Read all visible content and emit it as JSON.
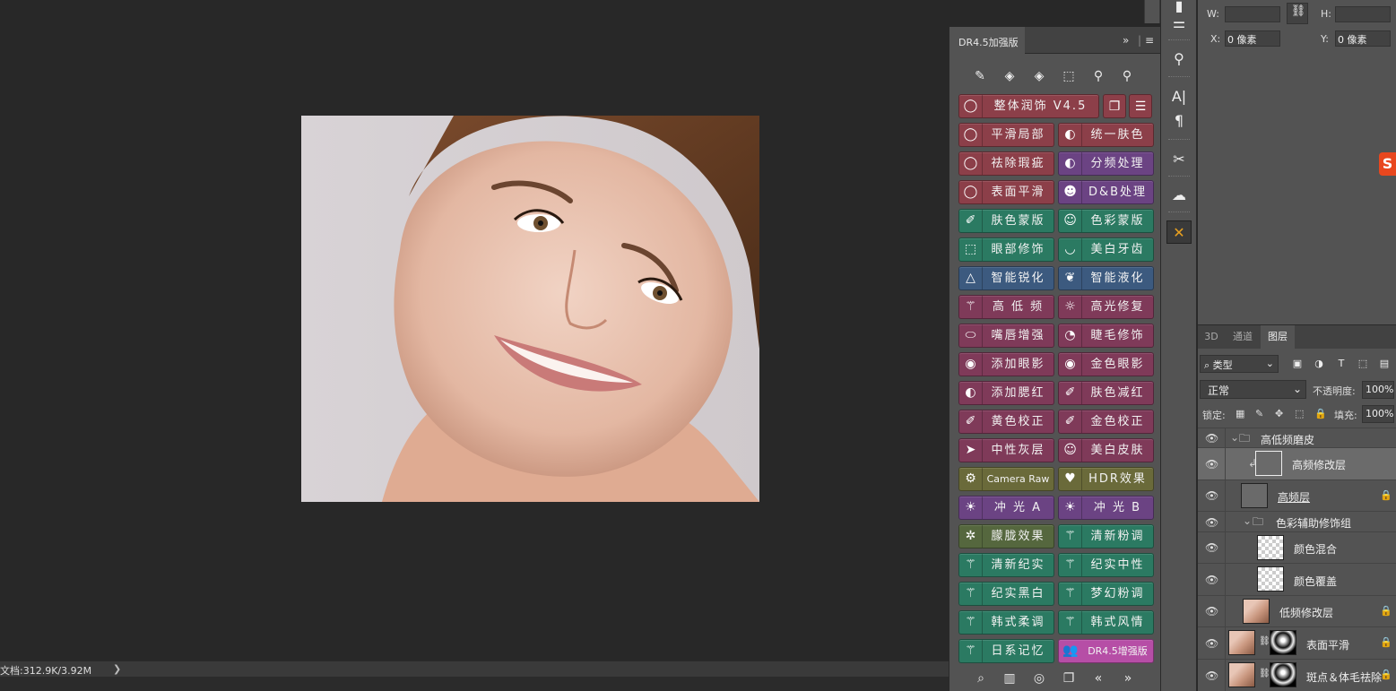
{
  "status": {
    "doc_info": "文档:312.9K/3.92M",
    "arrow": "❯"
  },
  "dr_panel": {
    "tab_title": "DR4.5加强版",
    "expand": "»",
    "menu": "≡",
    "toolbar_icons": [
      "brush-icon",
      "bandage-icon",
      "bandage-icon",
      "selection-icon",
      "stamp-icon",
      "stamp-icon"
    ],
    "buttons": {
      "main": "整体润饰  V4.5",
      "b1": "平滑局部",
      "b2": "统一肤色",
      "b3": "祛除瑕疵",
      "b4": "分频处理",
      "b5": "表面平滑",
      "b6": "D&B处理",
      "b7": "肤色蒙版",
      "b8": "色彩蒙版",
      "b9": "眼部修饰",
      "b10": "美白牙齿",
      "b11": "智能锐化",
      "b12": "智能液化",
      "b13": "高 低 频",
      "b14": "高光修复",
      "b15": "嘴唇增强",
      "b16": "睫毛修饰",
      "b17": "添加眼影",
      "b18": "金色眼影",
      "b19": "添加腮红",
      "b20": "肤色减红",
      "b21": "黄色校正",
      "b22": "金色校正",
      "b23": "中性灰层",
      "b24": "美白皮肤",
      "b25": "Camera Raw",
      "b26": "HDR效果",
      "b27": "冲 光 A",
      "b28": "冲 光 B",
      "b29": "朦胧效果",
      "b30": "清新粉调",
      "b31": "清新纪实",
      "b32": "纪实中性",
      "b33": "纪实黑白",
      "b34": "梦幻粉调",
      "b35": "韩式柔调",
      "b36": "韩式风情",
      "b37": "日系记忆",
      "b38": "DR4.5增强版"
    }
  },
  "toolcol": {
    "char_label": "A|",
    "para_label": "¶"
  },
  "properties": {
    "w_label": "W:",
    "h_label": "H:",
    "x_label": "X:",
    "x_value": "0 像素",
    "y_label": "Y:",
    "y_value": "0 像素"
  },
  "sogou_label": "S",
  "layers_panel": {
    "tabs": [
      "3D",
      "通道",
      "图层"
    ],
    "filter": "⌕ 类型",
    "blend_mode": "正常",
    "opacity_label": "不透明度:",
    "opacity_value": "100%",
    "lock_label": "锁定:",
    "fill_label": "填充:",
    "fill_value": "100%",
    "layers": [
      {
        "name": "高低频磨皮"
      },
      {
        "name": "高频修改层"
      },
      {
        "name": "高频层"
      },
      {
        "name": "色彩辅助修饰组"
      },
      {
        "name": "颜色混合"
      },
      {
        "name": "颜色覆盖"
      },
      {
        "name": "低频修改层"
      },
      {
        "name": "表面平滑"
      },
      {
        "name": "斑点＆体毛祛除"
      }
    ]
  }
}
